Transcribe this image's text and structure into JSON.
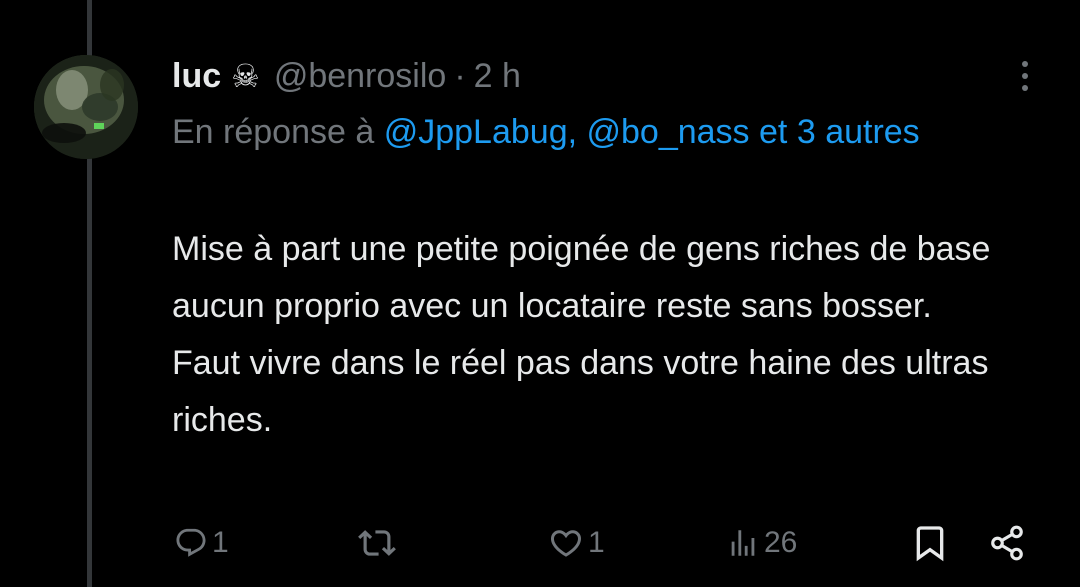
{
  "tweet": {
    "author": {
      "display_name": "luc",
      "emoji": "☠",
      "handle": "@benrosilo",
      "separator": "·",
      "time": "2 h"
    },
    "reply_to": {
      "prefix": "En réponse à",
      "mention_1": "@JppLabug,",
      "mention_2": "@bo_nass",
      "connector": "et 3",
      "others": "autres"
    },
    "text_lines": [
      "Mise à part une petite poignée de gens riches de base aucun proprio avec un locataire reste sans bosser.",
      "Faut vivre dans le réel pas dans votre haine des ultras riches."
    ],
    "stats": {
      "replies": "1",
      "retweets": "",
      "likes": "1",
      "views": "26"
    }
  },
  "icons": {
    "reply": "reply-icon",
    "retweet": "retweet-icon",
    "like": "heart-icon",
    "views": "views-chart-icon",
    "bookmark": "bookmark-icon",
    "share": "share-icon",
    "more": "more-dots-icon"
  },
  "colors": {
    "background": "#000000",
    "text": "#e7e9ea",
    "muted": "#71767b",
    "link": "#1d9bf0",
    "thread_line": "#333639"
  }
}
